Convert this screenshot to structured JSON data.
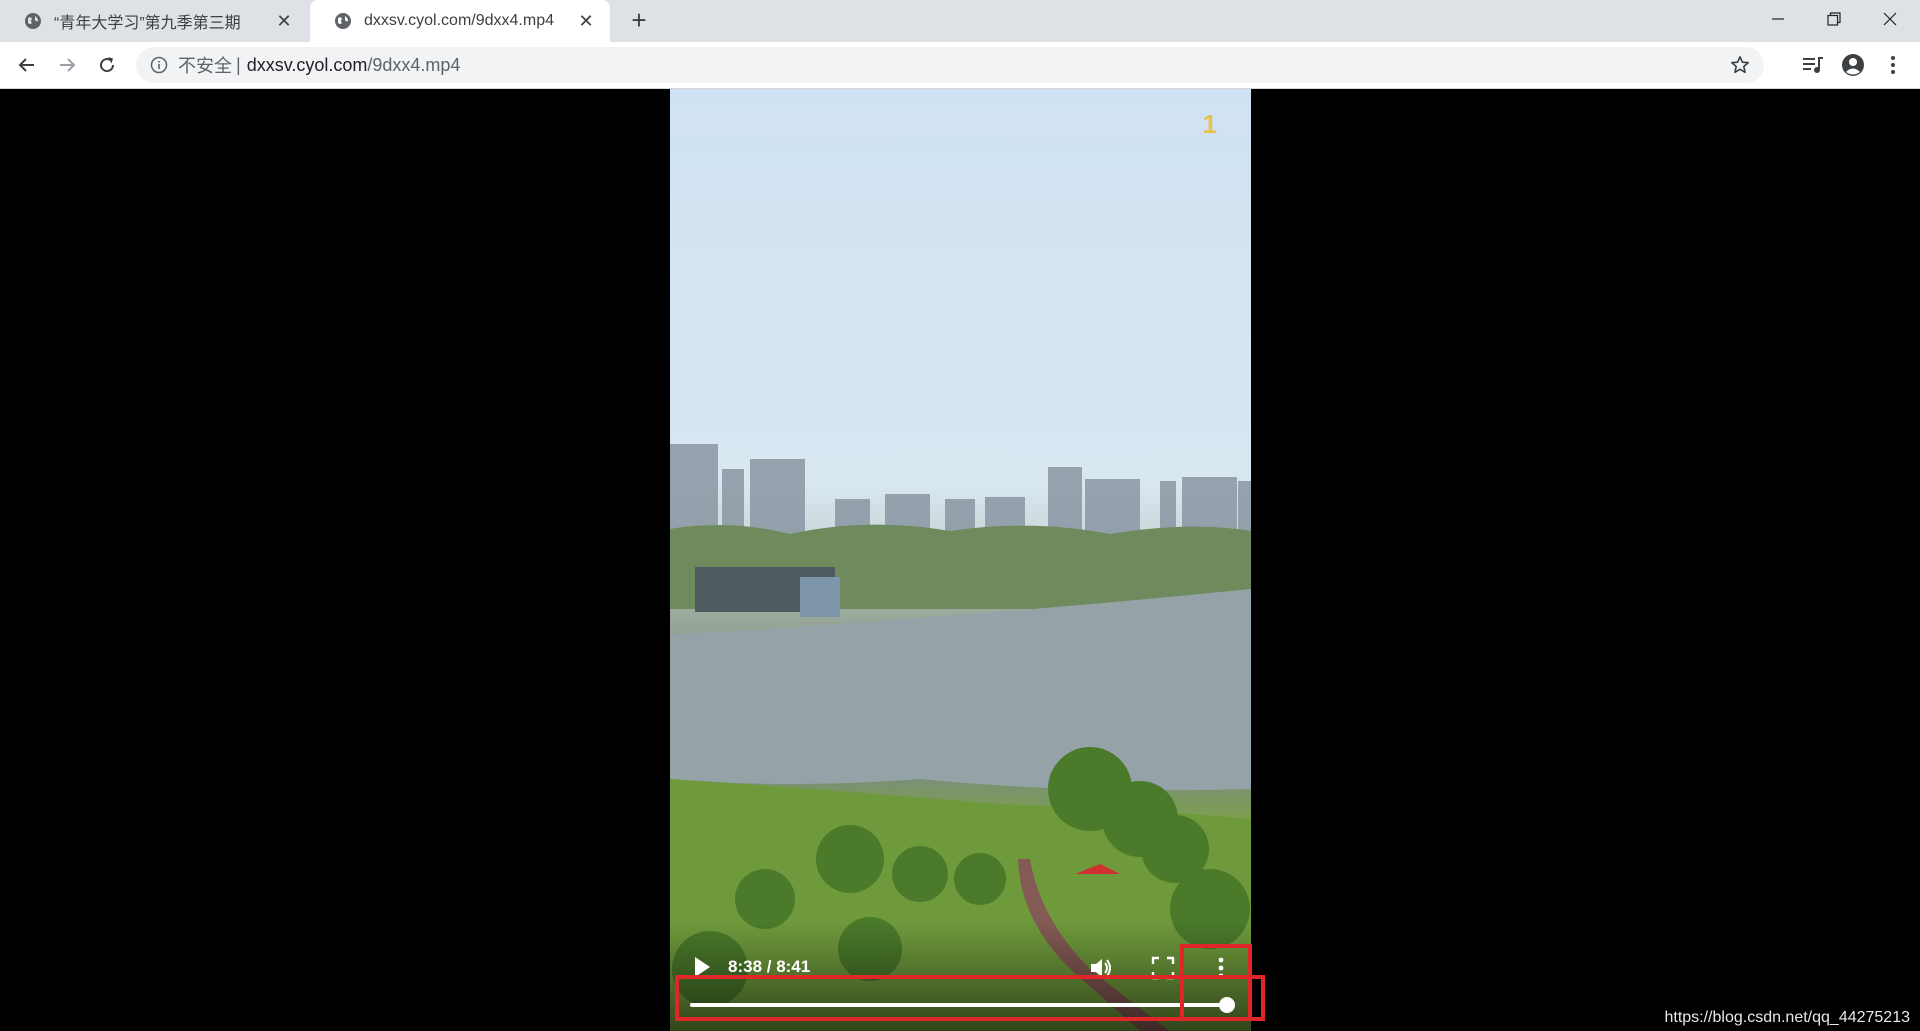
{
  "tabs": [
    {
      "title": "“青年大学习”第九季第三期",
      "active": false
    },
    {
      "title": "dxxsv.cyol.com/9dxx4.mp4",
      "active": true
    }
  ],
  "toolbar": {
    "security_label": "不安全",
    "separator": "|",
    "url_host": "dxxsv.cyol.com",
    "url_path": "/9dxx4.mp4"
  },
  "video": {
    "overlay_number": "1",
    "time_display": "8:38 / 8:41",
    "current_seconds": 518,
    "duration_seconds": 521,
    "progress_fraction": 0.994
  },
  "watermark": "https://blog.csdn.net/qq_44275213",
  "colors": {
    "highlight": "#e02626",
    "tabstrip": "#dee1e6",
    "omnibox": "#f1f3f4"
  },
  "icons": [
    "globe-icon",
    "close-icon",
    "plus-icon",
    "minimize-icon",
    "restore-icon",
    "back-icon",
    "forward-icon",
    "reload-icon",
    "info-icon",
    "star-icon",
    "media-control-icon",
    "profile-icon",
    "kebab-icon",
    "play-icon",
    "volume-icon",
    "fullscreen-icon"
  ]
}
